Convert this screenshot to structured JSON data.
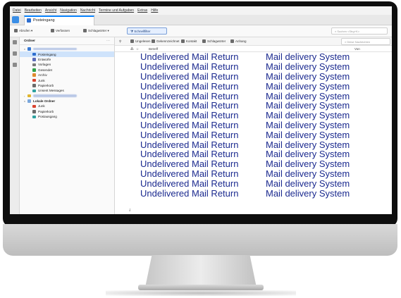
{
  "menu": [
    "Datei",
    "Bearbeiten",
    "Ansicht",
    "Navigation",
    "Nachricht",
    "Termine und Aufgaben",
    "Extras",
    "Hilfe"
  ],
  "tabs": [
    {
      "label": "Posteingang",
      "active": true
    }
  ],
  "toolbar": {
    "items": [
      {
        "label": "Abrufen",
        "icon": "download-icon"
      },
      {
        "label": "Verfassen",
        "icon": "pencil-icon"
      },
      {
        "label": "Schlagwörter",
        "icon": "tag-icon"
      }
    ],
    "quickfilter_label": "Schnellfilter",
    "search_placeholder": "Suchen <Strg+K>"
  },
  "folder_pane": {
    "title": "Ordner",
    "accounts": [
      {
        "name_redacted": true,
        "folders": [
          {
            "label": "Posteingang",
            "icon": "inbox-icon",
            "color": "#2e6ecf",
            "selected": true
          },
          {
            "label": "Entwürfe",
            "icon": "drafts-icon",
            "color": "#5b6ab8"
          },
          {
            "label": "Vorlagen",
            "icon": "templates-icon",
            "color": "#7a7a7a"
          },
          {
            "label": "Gesendet",
            "icon": "sent-icon",
            "color": "#2fa24a"
          },
          {
            "label": "Archiv",
            "icon": "archive-icon",
            "color": "#e08a2e"
          },
          {
            "label": "Junk",
            "icon": "junk-icon",
            "color": "#d9432f"
          },
          {
            "label": "Papierkorb",
            "icon": "trash-icon",
            "color": "#6b6b6b"
          },
          {
            "label": "Unsent Messages",
            "icon": "outbox-icon",
            "color": "#2fa2a0"
          }
        ]
      }
    ],
    "local_folders": {
      "title": "Lokale Ordner",
      "folders": [
        {
          "label": "Junk",
          "icon": "junk-icon",
          "color": "#d9432f"
        },
        {
          "label": "Papierkorb",
          "icon": "trash-icon",
          "color": "#6b6b6b"
        },
        {
          "label": "Postausgang",
          "icon": "outbox-icon",
          "color": "#2fa2a0"
        }
      ]
    }
  },
  "message_toolbar": {
    "filters": [
      {
        "label": "Ungelesen",
        "icon": "unread-icon"
      },
      {
        "label": "Gekennzeichnet",
        "icon": "star-icon"
      },
      {
        "label": "Kontakt",
        "icon": "contact-icon"
      },
      {
        "label": "Schlagwörter",
        "icon": "tag-icon"
      },
      {
        "label": "Anhang",
        "icon": "attachment-icon"
      }
    ],
    "search_placeholder": "Diese Nachrichten"
  },
  "columns": {
    "subject": "Betreff",
    "from": "Von"
  },
  "messages": [
    {
      "subject": "Undelivered Mail Return",
      "from": "Mail delivery System"
    },
    {
      "subject": "Undelivered Mail Return",
      "from": "Mail delivery System"
    },
    {
      "subject": "Undelivered Mail Return",
      "from": "Mail delivery System"
    },
    {
      "subject": "Undelivered Mail Return",
      "from": "Mail delivery System"
    },
    {
      "subject": "Undelivered Mail Return",
      "from": "Mail delivery System"
    },
    {
      "subject": "Undelivered Mail Return",
      "from": "Mail delivery System"
    },
    {
      "subject": "Undelivered Mail Return",
      "from": "Mail delivery System"
    },
    {
      "subject": "Undelivered Mail Return",
      "from": "Mail delivery System"
    },
    {
      "subject": "Undelivered Mail Return",
      "from": "Mail delivery System"
    },
    {
      "subject": "Undelivered Mail Return",
      "from": "Mail delivery System"
    },
    {
      "subject": "Undelivered Mail Return",
      "from": "Mail delivery System"
    },
    {
      "subject": "Undelivered Mail Return",
      "from": "Mail delivery System"
    },
    {
      "subject": "Undelivered Mail Return",
      "from": "Mail delivery System"
    },
    {
      "subject": "Undelivered Mail Return",
      "from": "Mail delivery System"
    },
    {
      "subject": "Undelivered Mail Return",
      "from": "Mail delivery System"
    }
  ],
  "colors": {
    "accent": "#0a84ff",
    "message_text": "#1b2a8f",
    "selection": "#cfe3fb"
  }
}
